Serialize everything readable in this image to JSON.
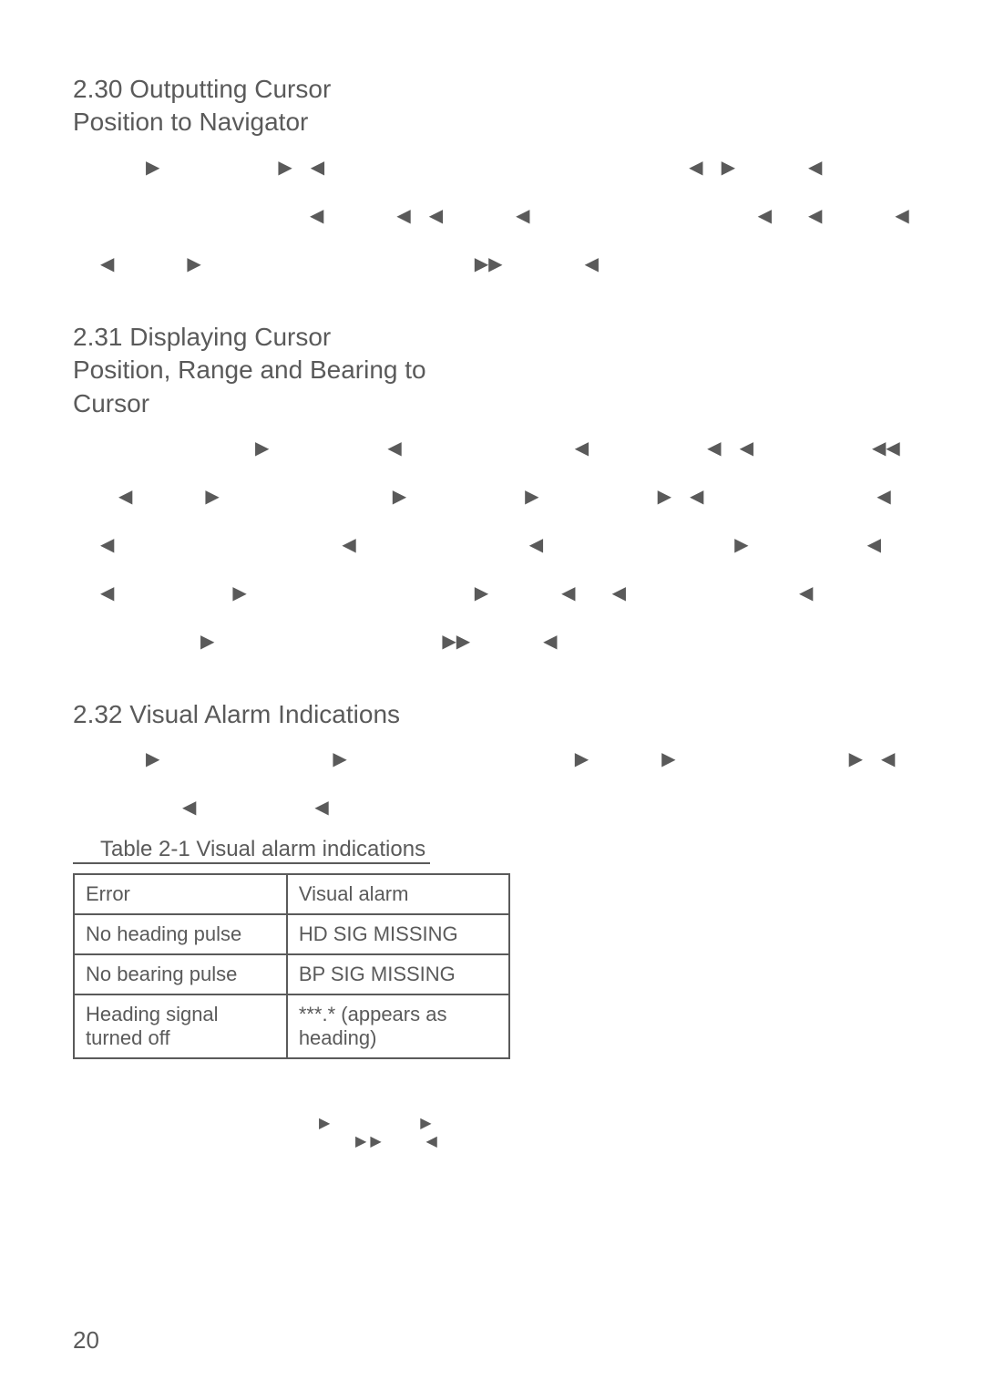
{
  "headings": {
    "h230_line1": "2.30 Outputting Cursor",
    "h230_line2": "Position to Navigator",
    "h231_line1": "2.31 Displaying Cursor",
    "h231_line2": "Position, Range and Bearing to",
    "h231_line3": "Cursor",
    "h232": "2.32 Visual Alarm Indications"
  },
  "table": {
    "caption": "Table 2-1 Visual alarm indications",
    "rows": [
      {
        "col1": "Error",
        "col2": "Visual alarm"
      },
      {
        "col1": "No heading pulse",
        "col2": "HD SIG MISSING"
      },
      {
        "col1": "No bearing pulse",
        "col2": "BP SIG MISSING"
      },
      {
        "col1": "Heading signal turned off",
        "col2": "***.* (appears as heading)"
      }
    ]
  },
  "page_number": "20",
  "glyphs": {
    "right": "▶",
    "left": "◀"
  }
}
